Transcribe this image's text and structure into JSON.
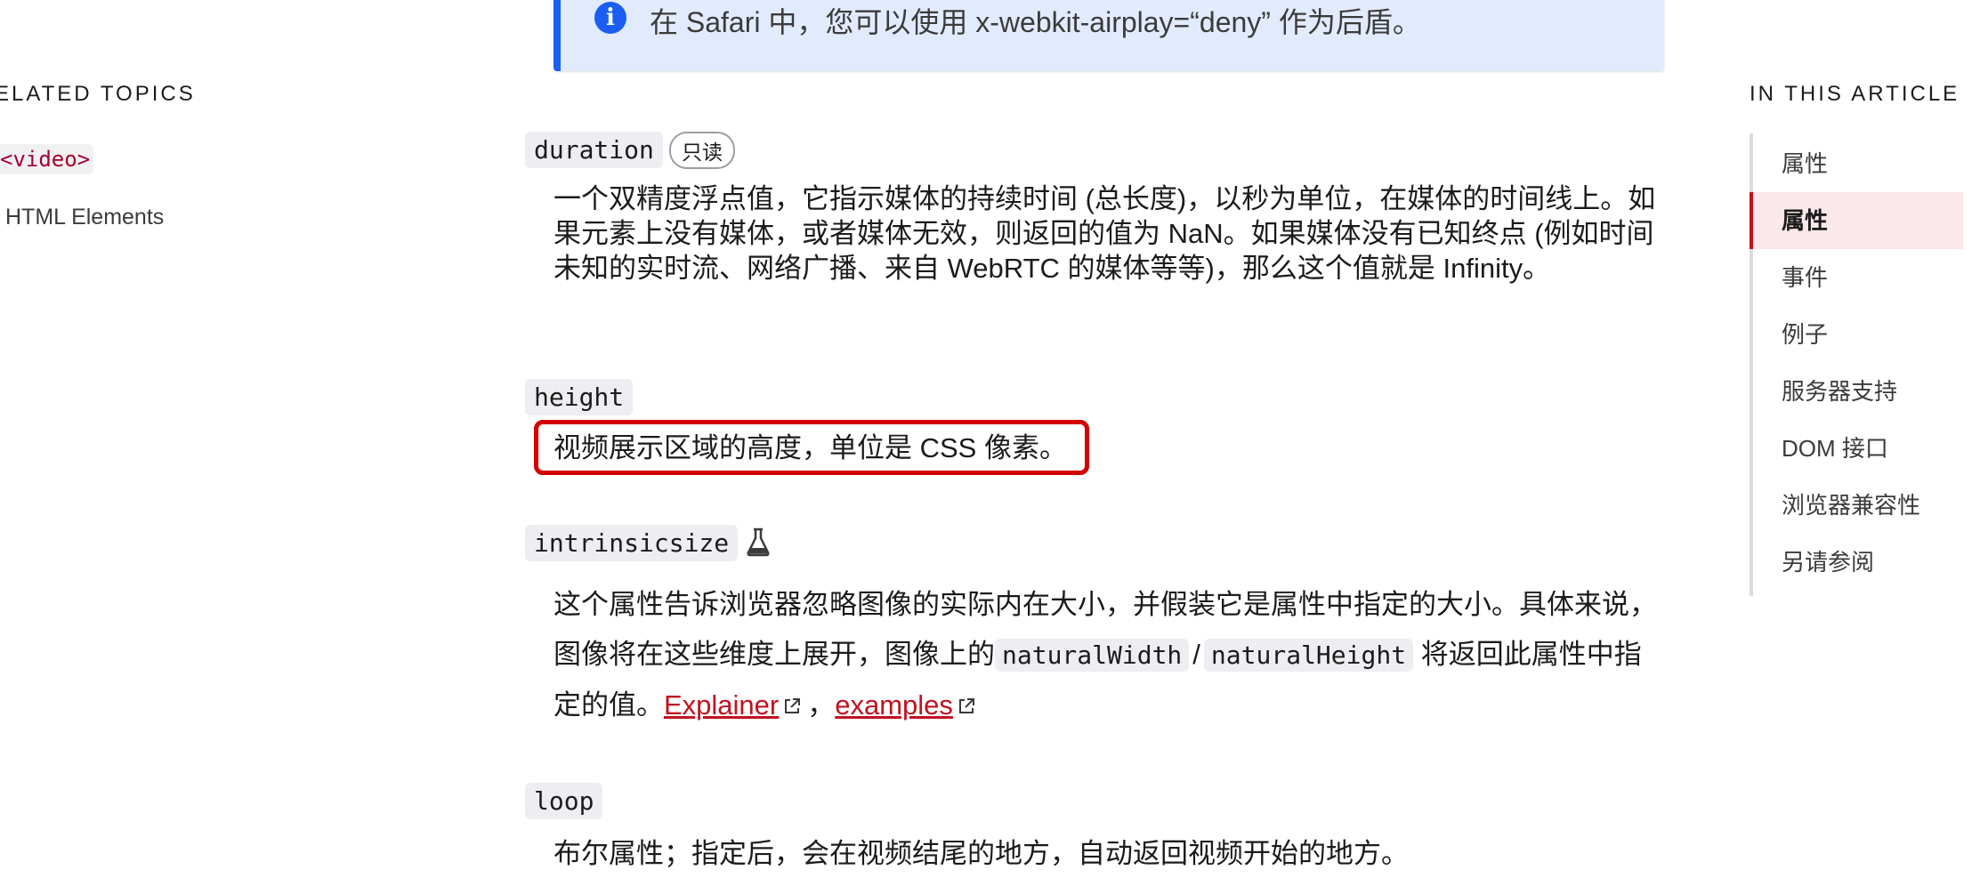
{
  "note": {
    "icon": "info-icon",
    "text": "在 Safari 中，您可以使用 x-webkit-airplay=“deny” 作为后盾。"
  },
  "related": {
    "heading": "ELATED TOPICS",
    "items": [
      {
        "label": "<video>"
      },
      {
        "label": "HTML Elements"
      }
    ]
  },
  "attributes": [
    {
      "name": "duration",
      "badge": "只读",
      "description": "一个双精度浮点值，它指示媒体的持续时间 (总长度)，以秒为单位，在媒体的时间线上。如果元素上没有媒体，或者媒体无效，则返回的值为 NaN。如果媒体没有已知终点 (例如时间未知的实时流、网络广播、来自 WebRTC 的媒体等等)，那么这个值就是 Infinity。"
    },
    {
      "name": "height",
      "description": "视频展示区域的高度，单位是 CSS 像素。"
    },
    {
      "name": "intrinsicsize",
      "experimental_icon": "flask-icon",
      "description_parts": {
        "before": "这个属性告诉浏览器忽略图像的实际内在大小，并假装它是属性中指定的大小。具体来说，图像将在这些维度上展开，图像上的",
        "code1": "naturalWidth",
        "slash": "/",
        "code2": "naturalHeight",
        "after": " 将返回此属性中指定的值。",
        "link1": "Explainer",
        "comma": "，",
        "link2": "examples"
      }
    },
    {
      "name": "loop",
      "description": "布尔属性；指定后，会在视频结尾的地方，自动返回视频开始的地方。"
    }
  ],
  "toc": {
    "heading": "IN THIS ARTICLE",
    "items": [
      {
        "label": "属性",
        "active": false
      },
      {
        "label": "属性",
        "active": true
      },
      {
        "label": "事件",
        "active": false
      },
      {
        "label": "例子",
        "active": false
      },
      {
        "label": "服务器支持",
        "active": false
      },
      {
        "label": "DOM 接口",
        "active": false
      },
      {
        "label": "浏览器兼容性",
        "active": false
      },
      {
        "label": "另请参阅",
        "active": false
      }
    ]
  },
  "colors": {
    "accent": "#c1121f",
    "note_border": "#1a5ef2",
    "highlight": "#d40000"
  }
}
